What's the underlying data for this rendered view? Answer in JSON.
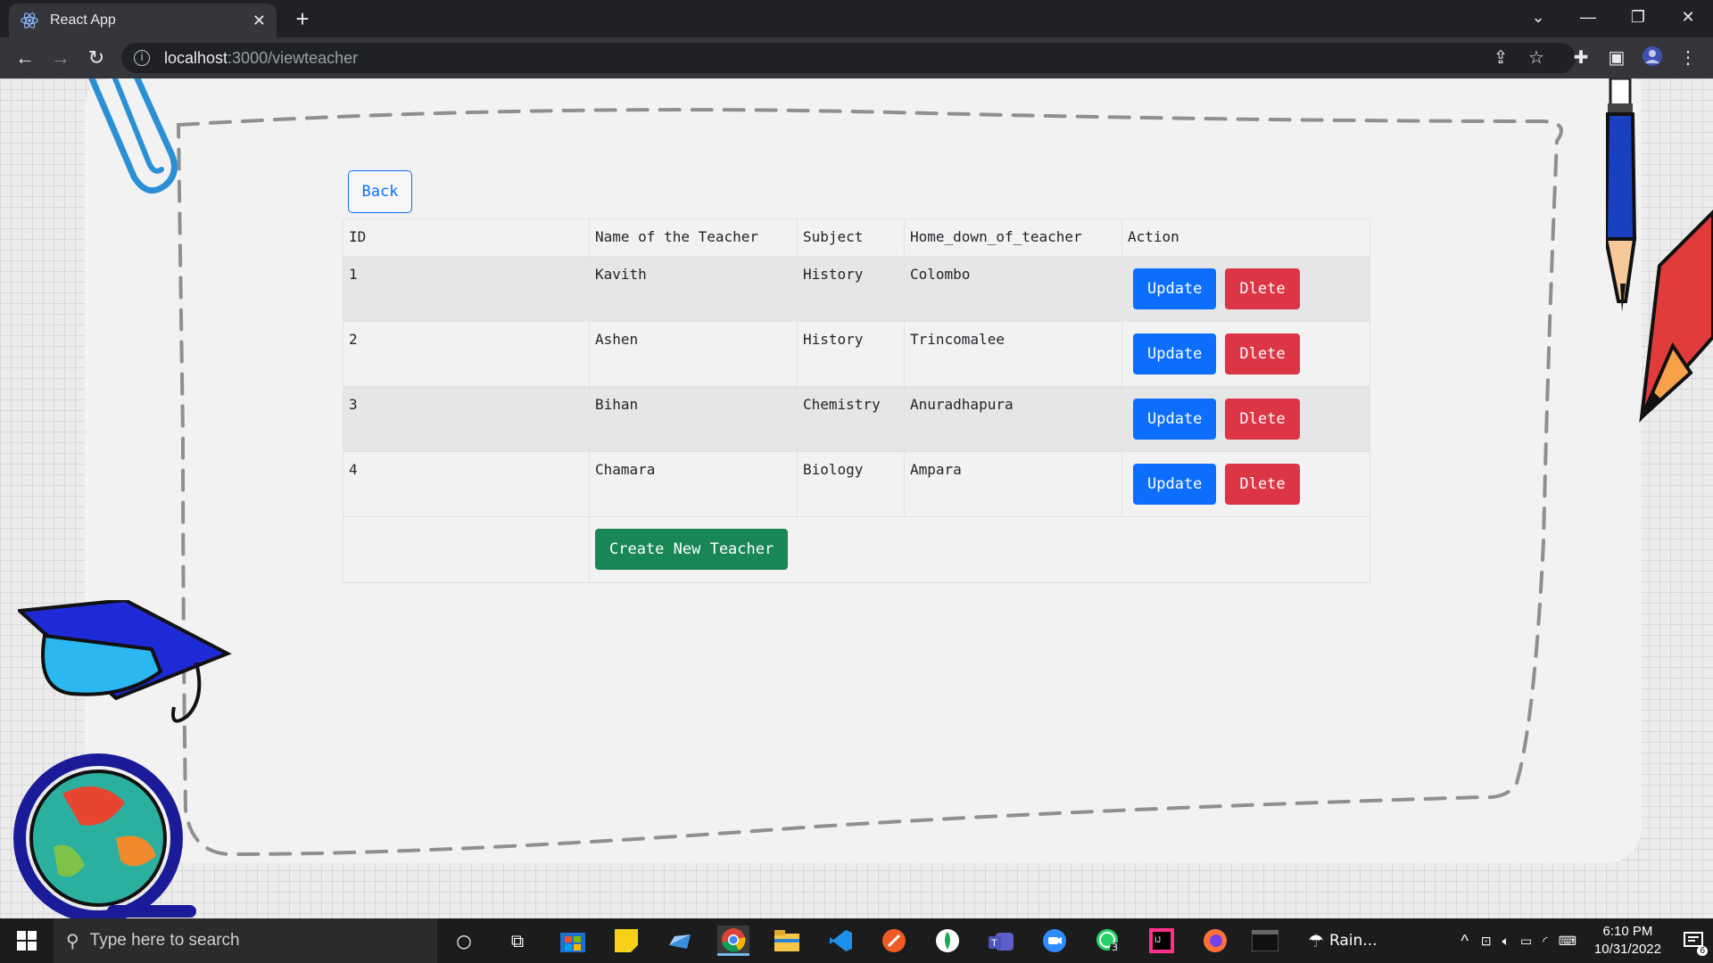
{
  "browser": {
    "tab_title": "React App",
    "url_host": "localhost",
    "url_path": ":3000/viewteacher"
  },
  "page": {
    "back_label": "Back",
    "table": {
      "headers": [
        "ID",
        "Name of the Teacher",
        "Subject",
        "Home_down_of_teacher",
        "Action"
      ],
      "rows": [
        {
          "id": "1",
          "name": "Kavith",
          "subject": "History",
          "home": "Colombo"
        },
        {
          "id": "2",
          "name": "Ashen",
          "subject": "History",
          "home": "Trincomalee"
        },
        {
          "id": "3",
          "name": "Bihan",
          "subject": "Chemistry",
          "home": "Anuradhapura"
        },
        {
          "id": "4",
          "name": "Chamara",
          "subject": "Biology",
          "home": "Ampara"
        }
      ],
      "update_label": "Update",
      "delete_label": "Dlete"
    },
    "create_label": "Create New Teacher"
  },
  "taskbar": {
    "search_placeholder": "Type here to search",
    "weather": "Rain...",
    "time": "6:10 PM",
    "date": "10/31/2022",
    "whatsapp_badge": "3",
    "notifications_badge": "6"
  },
  "colors": {
    "primary": "#0d6efd",
    "danger": "#dc3545",
    "success": "#198754"
  }
}
